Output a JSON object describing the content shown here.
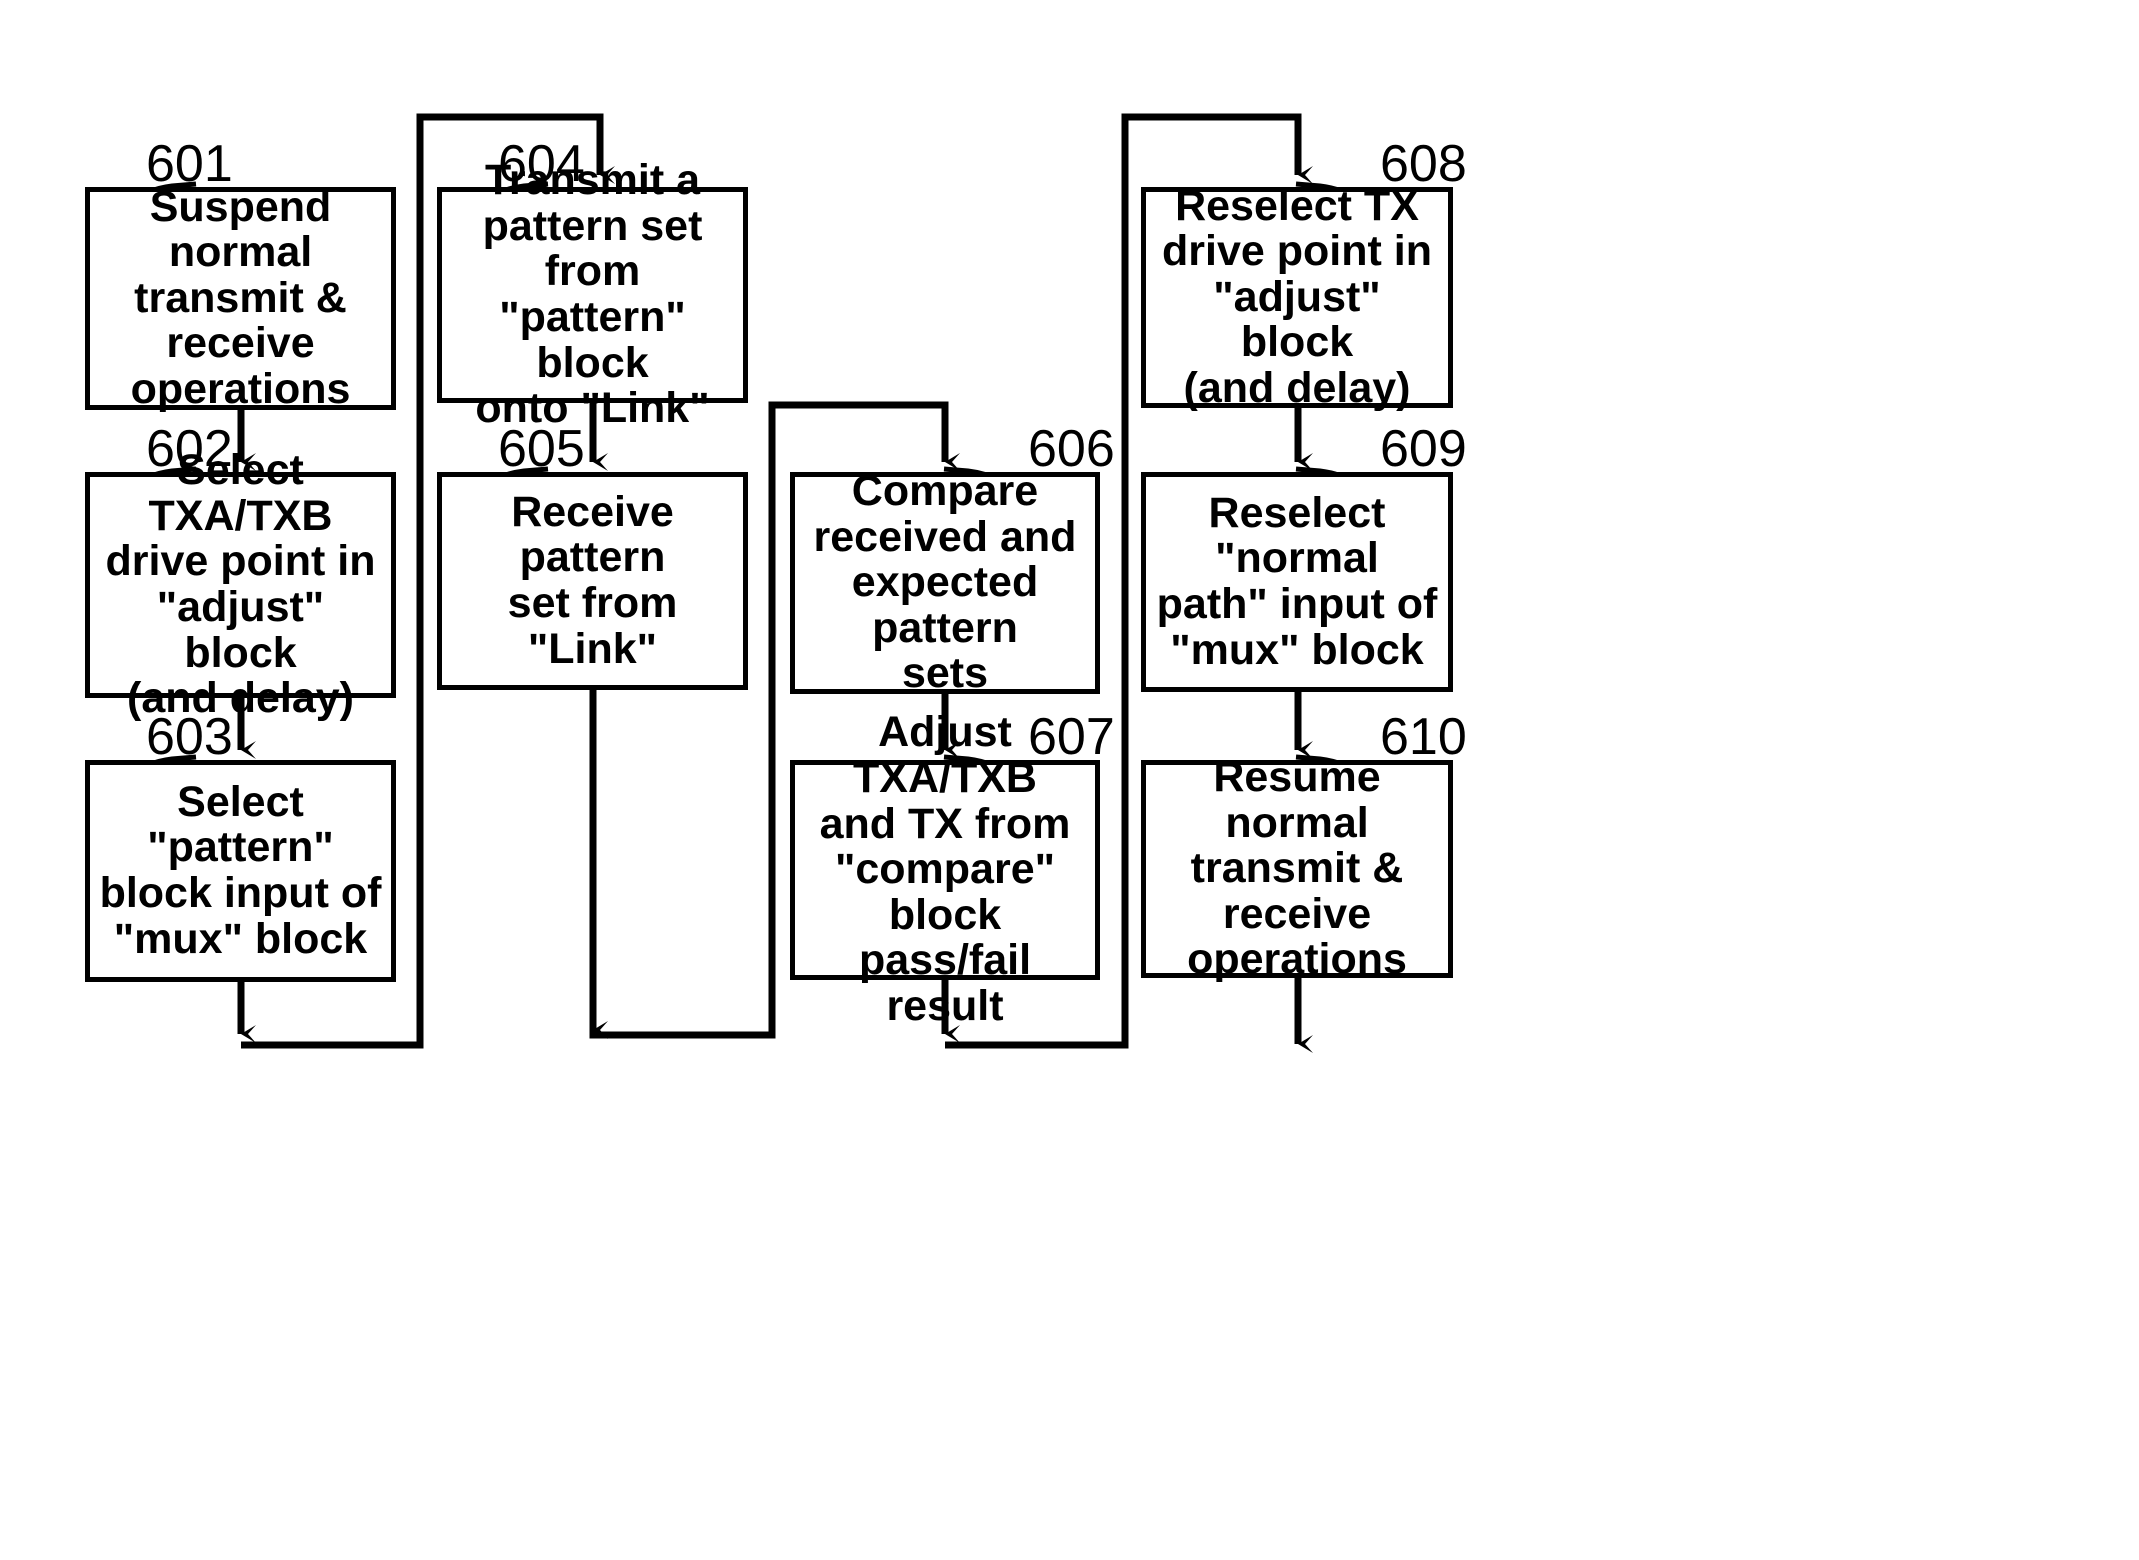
{
  "figure": {
    "type": "flowchart",
    "background_color": "#ffffff",
    "line_color": "#000000",
    "text_color": "#000000"
  },
  "nodes": [
    {
      "ref": "601",
      "text": "Suspend normal\ntransmit &\nreceive\noperations",
      "lines": [
        "Suspend normal",
        "transmit &",
        "receive",
        "operations"
      ]
    },
    {
      "ref": "602",
      "text": "Select TXA/TXB\ndrive point in\n\"adjust\" block\n(and delay)",
      "lines": [
        "Select TXA/TXB",
        "drive point in",
        "\"adjust\" block",
        "(and delay)"
      ]
    },
    {
      "ref": "603",
      "text": "Select \"pattern\"\nblock input of\n\"mux\" block",
      "lines": [
        "Select \"pattern\"",
        "block input of",
        "\"mux\" block"
      ]
    },
    {
      "ref": "604",
      "text": "Transmit a\npattern set from\n\"pattern\" block\nonto \"Link\"",
      "lines": [
        "Transmit a",
        "pattern set from",
        "\"pattern\" block",
        "onto \"Link\""
      ]
    },
    {
      "ref": "605",
      "text": "Receive pattern\nset from \"Link\"",
      "lines": [
        "Receive pattern",
        "set from \"Link\""
      ]
    },
    {
      "ref": "606",
      "text": "Compare\nreceived and\nexpected pattern\nsets",
      "lines": [
        "Compare",
        "received and",
        "expected pattern",
        "sets"
      ]
    },
    {
      "ref": "607",
      "text": "Adjust TXA/TXB\nand TX from\n\"compare\" block\npass/fail result",
      "lines": [
        "Adjust TXA/TXB",
        "and TX from",
        "\"compare\" block",
        "pass/fail result"
      ]
    },
    {
      "ref": "608",
      "text": "Reselect TX\ndrive point in\n\"adjust\" block\n(and delay)",
      "lines": [
        "Reselect TX",
        "drive point in",
        "\"adjust\" block",
        "(and delay)"
      ]
    },
    {
      "ref": "609",
      "text": "Reselect \"normal\npath\" input of\n\"mux\" block",
      "lines": [
        "Reselect \"normal",
        "path\" input of",
        "\"mux\" block"
      ]
    },
    {
      "ref": "610",
      "text": "Resume normal\ntransmit &\nreceive\noperations",
      "lines": [
        "Resume normal",
        "transmit &",
        "receive",
        "operations"
      ]
    }
  ],
  "ref_labels": {
    "n601": "601",
    "n602": "602",
    "n603": "603",
    "n604": "604",
    "n605": "605",
    "n606": "606",
    "n607": "607",
    "n608": "608",
    "n609": "609",
    "n610": "610"
  }
}
